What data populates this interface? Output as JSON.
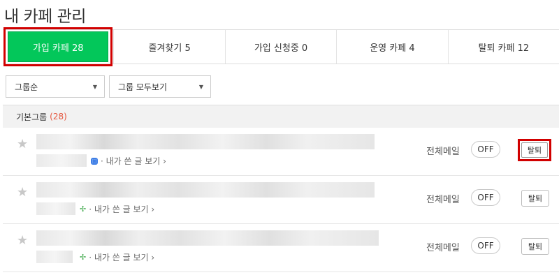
{
  "page_title": "내 카페 관리",
  "tabs": [
    {
      "label": "가입 카페 28",
      "active": true
    },
    {
      "label": "즐겨찾기 5",
      "active": false
    },
    {
      "label": "가입 신청중 0",
      "active": false
    },
    {
      "label": "운영 카페 4",
      "active": false
    },
    {
      "label": "탈퇴 카페 12",
      "active": false
    }
  ],
  "filters": {
    "sort": "그룹순",
    "group": "그룹 모두보기"
  },
  "group": {
    "name": "기본그룹",
    "count": "(28)"
  },
  "cafes": [
    {
      "my_posts": "내가 쓴 글 보기",
      "mail_label": "전체메일",
      "mail_toggle": "OFF",
      "leave_label": "탈퇴",
      "badge": "blue"
    },
    {
      "my_posts": "내가 쓴 글 보기",
      "mail_label": "전체메일",
      "mail_toggle": "OFF",
      "leave_label": "탈퇴",
      "badge": "green"
    },
    {
      "my_posts": "내가 쓴 글 보기",
      "mail_label": "전체메일",
      "mail_toggle": "OFF",
      "leave_label": "탈퇴",
      "badge": "green"
    }
  ],
  "colors": {
    "active_tab": "#03c75a",
    "highlight": "#d10000",
    "group_count": "#e5553d"
  },
  "icons": {
    "star": "star-icon",
    "caret": "caret-down-icon",
    "chevron": "chevron-right-icon"
  }
}
